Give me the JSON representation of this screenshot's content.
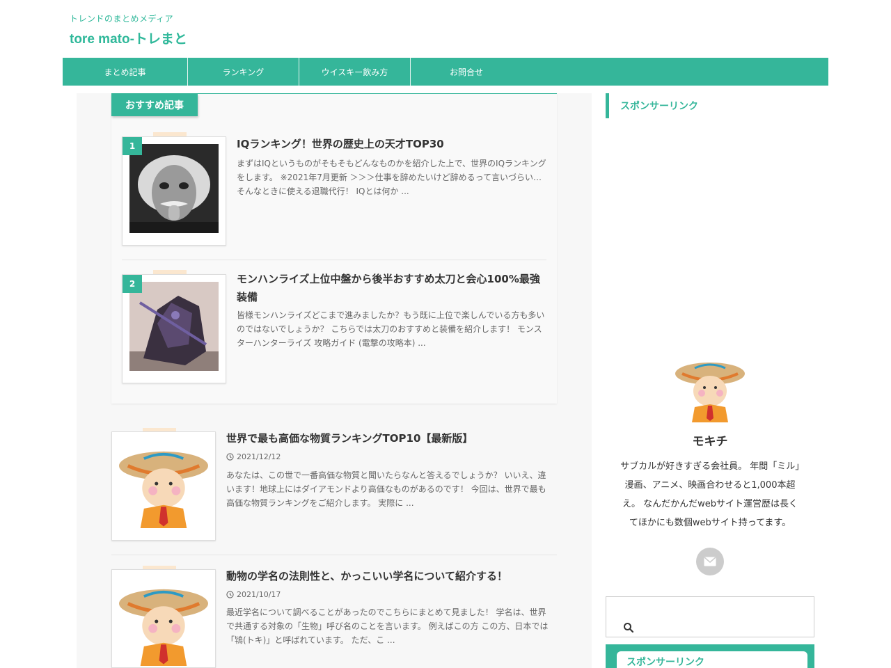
{
  "header": {
    "tagline": "トレンドのまとめメディア",
    "site_title": "tore mato-トレまと"
  },
  "nav": {
    "items": [
      {
        "label": "まとめ記事"
      },
      {
        "label": "ランキング"
      },
      {
        "label": "ウイスキー飲み方"
      },
      {
        "label": "お問合せ"
      }
    ]
  },
  "recommended": {
    "heading": "おすすめ記事",
    "items": [
      {
        "rank": "1",
        "title": "IQランキング！世界の歴史上の天才TOP30",
        "excerpt": "まずはIQというものがそもそもどんなものかを紹介した上で、世界のIQランキングをします。 ※2021年7月更新 ＞＞＞仕事を辞めたいけど辞めるって言いづらい…そんなときに使える退職代行！ IQとは何か ..."
      },
      {
        "rank": "2",
        "title": "モンハンライズ上位中盤から後半おすすめ太刀と会心100%最強装備",
        "excerpt": "皆様モンハンライズどこまで進みましたか？もう既に上位で楽しんでいる方も多いのではないでしょうか？ こちらでは太刀のおすすめと装備を紹介します！ モンスターハンターライズ 攻略ガイド (電撃の攻略本) ..."
      }
    ]
  },
  "articles": [
    {
      "title": "世界で最も高価な物質ランキングTOP10【最新版】",
      "date": "2021/12/12",
      "excerpt": "あなたは、この世で一番高価な物質と聞いたらなんと答えるでしょうか？ いいえ、違います！地球上にはダイアモンドより高価なものがあるのです！ 今回は、世界で最も高価な物質ランキングをご紹介します。 実際に ..."
    },
    {
      "title": "動物の学名の法則性と、かっこいい学名について紹介する！",
      "date": "2021/10/17",
      "excerpt": "最近学名について調べることがあったのでこちらにまとめて見ました！ 学名は、世界で共通する対象の「生物」呼び名のことを言います。 例えばこの方 この方、日本では「鴇(トキ)」と呼ばれています。 ただ、こ ..."
    }
  ],
  "sidebar": {
    "sponsor_heading": "スポンサーリンク",
    "profile_name": "モキチ",
    "profile_bio": "サブカルが好きすぎる会社員。 年間「ミル」漫画、アニメ、映画合わせると1,000本超え。 なんだかんだwebサイト運営歴は長くてほかにも数個webサイト持ってます。",
    "search_placeholder": "",
    "sponsor_heading_2": "スポンサーリンク"
  },
  "colors": {
    "accent": "#35b69a",
    "tape": "#fbe7cf"
  }
}
